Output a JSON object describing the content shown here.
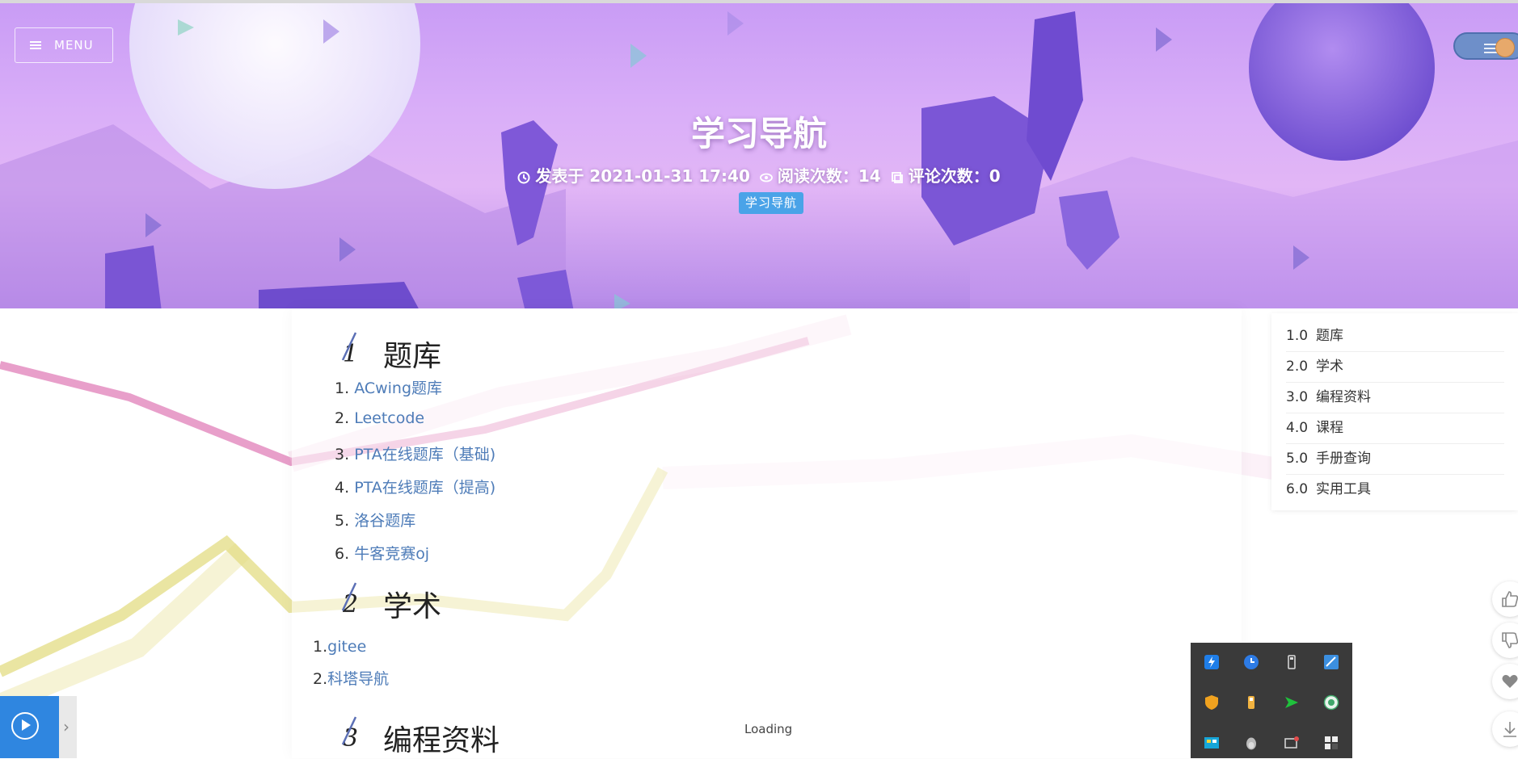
{
  "header": {
    "menu_label": "MENU",
    "title": "学习导航",
    "meta": {
      "published": "发表于 2021-01-31 17:40",
      "views": "阅读次数：14",
      "comments": "评论次数：0"
    },
    "tag": "学习导航"
  },
  "article": {
    "sections": [
      {
        "num": "1",
        "title": "题库",
        "links": [
          {
            "n": "1.",
            "text": "ACwing题库"
          },
          {
            "n": "2.",
            "text": "Leetcode"
          },
          {
            "n": "3.",
            "text": "PTA在线题库（基础)"
          },
          {
            "n": "4.",
            "text": "PTA在线题库（提高)"
          },
          {
            "n": "5.",
            "text": "洛谷题库"
          },
          {
            "n": "6.",
            "text": "牛客竞赛oj"
          }
        ]
      },
      {
        "num": "2",
        "title": "学术",
        "links": [
          {
            "n": "1.",
            "text": "gitee"
          },
          {
            "n": "2.",
            "text": "科塔导航"
          }
        ]
      },
      {
        "num": "3",
        "title": "编程资料"
      }
    ]
  },
  "toc": [
    {
      "n": "1.0",
      "label": "题库"
    },
    {
      "n": "2.0",
      "label": "学术"
    },
    {
      "n": "3.0",
      "label": "编程资料"
    },
    {
      "n": "4.0",
      "label": "课程"
    },
    {
      "n": "5.0",
      "label": "手册查询"
    },
    {
      "n": "6.0",
      "label": "实用工具"
    }
  ],
  "floating_buttons": [
    "thumbs-up-icon",
    "thumbs-down-icon",
    "heart-icon",
    "download-icon"
  ],
  "player": {
    "loading_text": "Loading"
  },
  "colors": {
    "link": "#4e7cb8",
    "tag": "#4aa3e8",
    "player": "#2f86e0"
  }
}
